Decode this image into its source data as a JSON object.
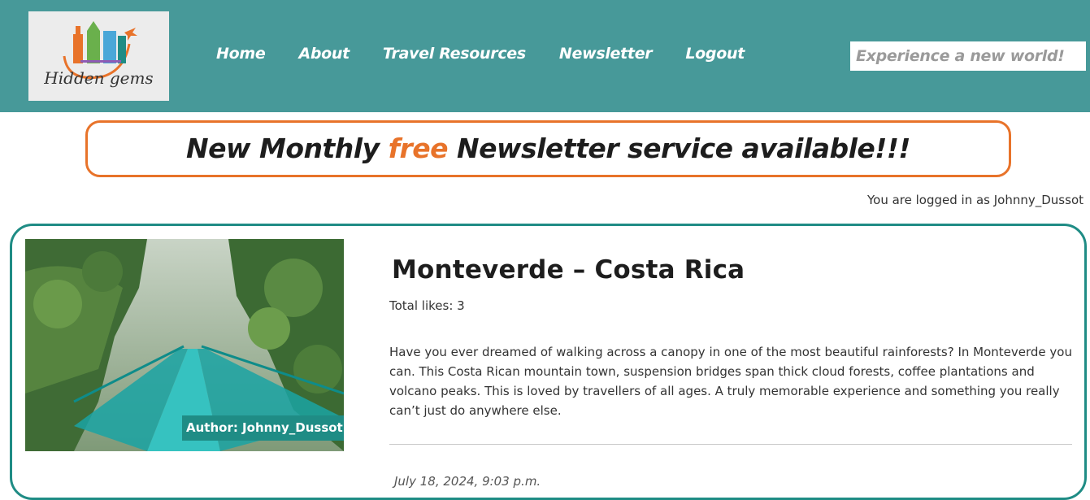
{
  "header": {
    "logo_text": "Hidden gems",
    "nav": [
      "Home",
      "About",
      "Travel Resources",
      "Newsletter",
      "Logout"
    ],
    "tagline": "Experience a new world!"
  },
  "banner": {
    "part1": "New Monthly ",
    "highlight": "free",
    "part2": " Newsletter service available!!!"
  },
  "login_status": "You are logged in as Johnny_Dussot",
  "post": {
    "title": "Monteverde – Costa Rica",
    "likes": "Total likes: 3",
    "body": "Have you ever dreamed of walking across a canopy in one of the most beautiful rainforests? In Monteverde you can. This Costa Rican mountain town, suspension bridges span thick cloud forests, coffee plantations and volcano peaks. This is loved by travellers of all ages. A truly memorable experience and something you really can’t just do anywhere else.",
    "author": "Author: Johnny_Dussot",
    "date": "July 18, 2024, 9:03 p.m."
  },
  "colors": {
    "header_bg": "#479999",
    "accent_orange": "#e8732a",
    "card_border": "#1f8c85"
  }
}
